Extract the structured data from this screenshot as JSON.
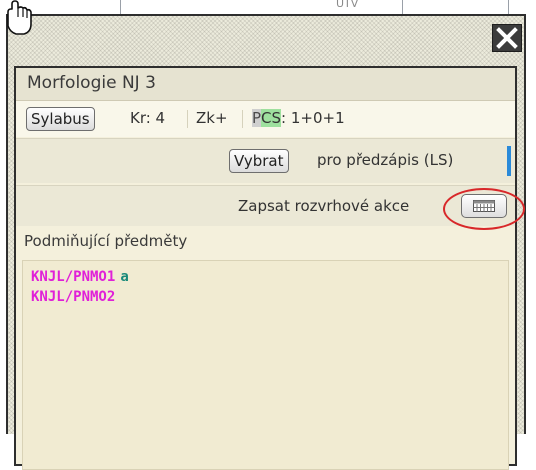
{
  "background": {
    "snippet_text": "UTV"
  },
  "popup": {
    "close_label": "close",
    "course_title": "Morfologie NJ 3",
    "syllabus_button": "Sylabus",
    "credits": "Kr: 4",
    "exam": "Zk+",
    "pcs_label_p": "P",
    "pcs_label_cs": "CS",
    "pcs_value": ": 1+0+1",
    "select_button": "Vybrat",
    "preregistration_text": "pro předzápis (LS)",
    "schedule_text": "Zapsat rozvrhové akce",
    "prerequisites_label": "Podmiňující předměty",
    "prerequisites": [
      {
        "code": "KNJL/PNMO1",
        "conjunction": "a"
      },
      {
        "code": "KNJL/PNMO2",
        "conjunction": ""
      }
    ]
  },
  "colors": {
    "accent_blue": "#2a8ad9",
    "highlight_red": "#d8282a",
    "course_code_magenta": "#e020d8",
    "conjunction_teal": "#1a8a7a",
    "pcs_green": "#9ee09e"
  },
  "icons": {
    "cursor": "hand-cursor-icon",
    "close": "close-icon",
    "schedule": "calendar-grid-icon"
  }
}
